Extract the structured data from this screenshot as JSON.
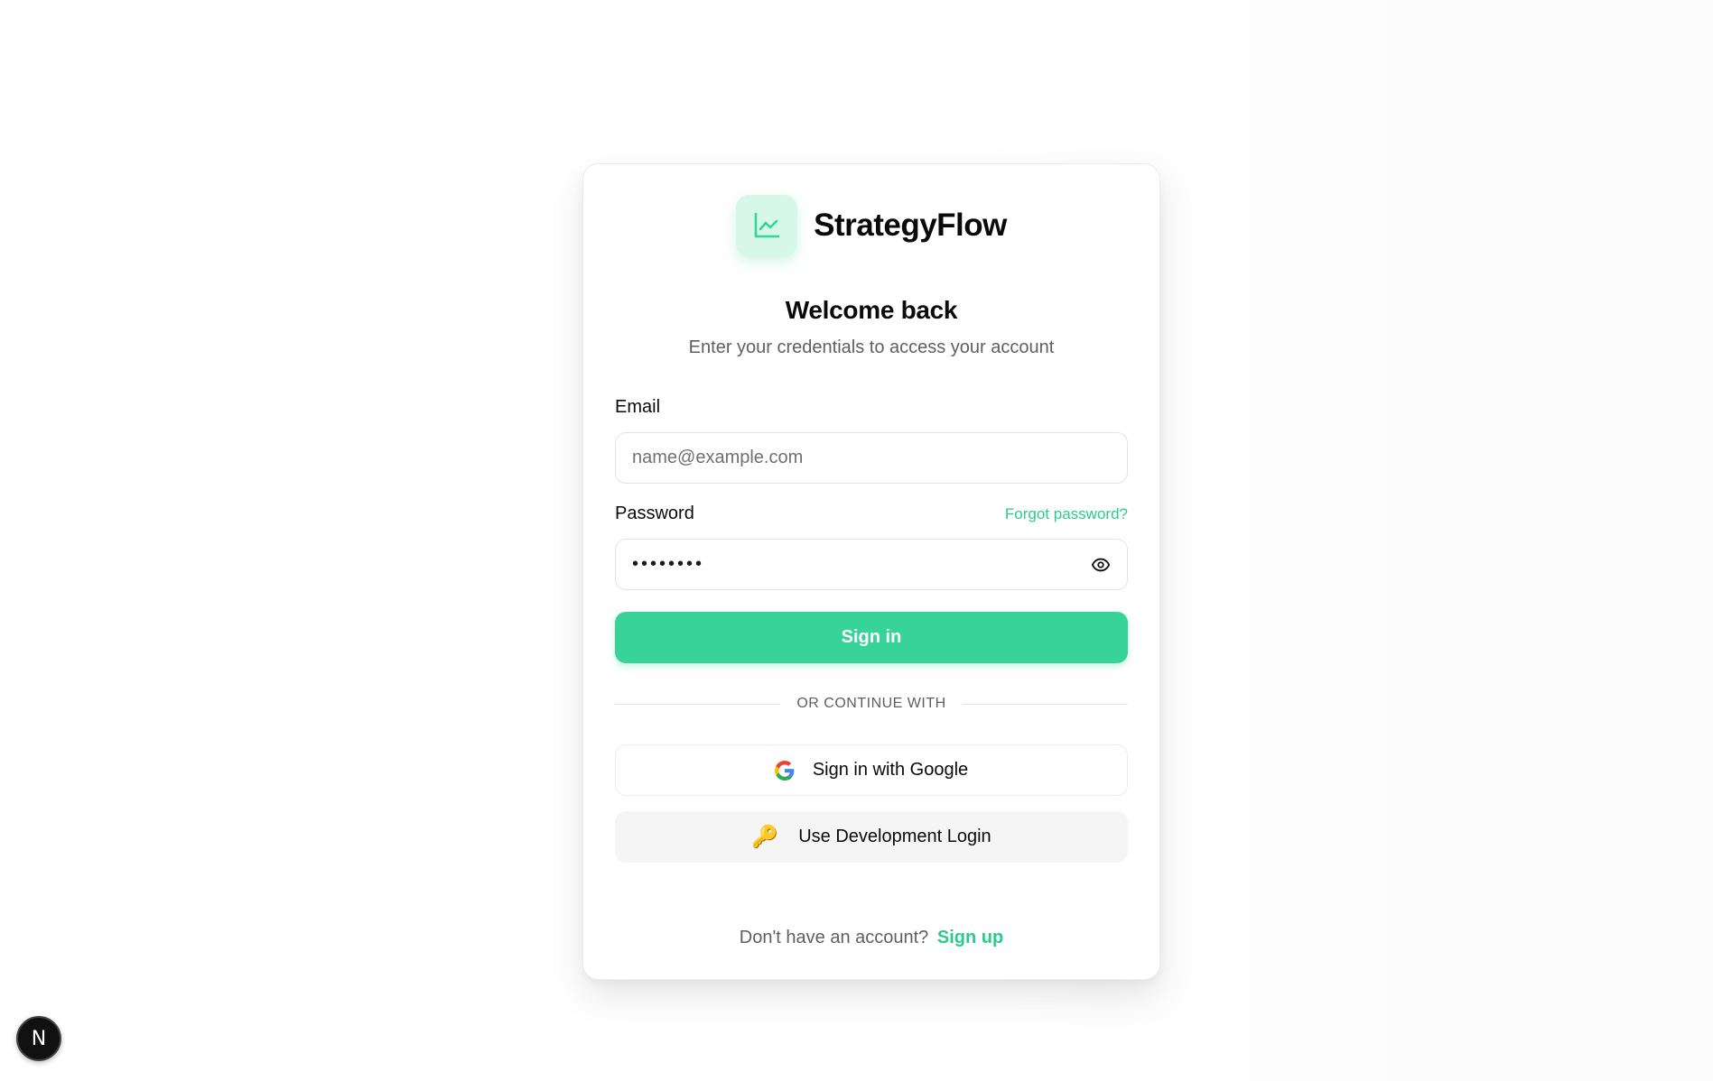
{
  "brand": {
    "name": "StrategyFlow",
    "logo_icon": "chart-line-icon",
    "accent_color": "#38d399"
  },
  "header": {
    "title": "Welcome back",
    "subtitle": "Enter your credentials to access your account"
  },
  "form": {
    "email": {
      "label": "Email",
      "placeholder": "name@example.com",
      "value": ""
    },
    "password": {
      "label": "Password",
      "forgot_link": "Forgot password?",
      "value": "password",
      "toggle_icon": "eye-icon"
    },
    "submit_label": "Sign in"
  },
  "divider": {
    "text": "OR CONTINUE WITH"
  },
  "social": {
    "google_label": "Sign in with Google",
    "google_icon": "google-icon",
    "dev_label": "Use Development Login",
    "dev_icon": "key-icon"
  },
  "footer": {
    "prompt": "Don't have an account?",
    "signup_link": "Sign up"
  },
  "dev_badge": {
    "letter": "N"
  }
}
